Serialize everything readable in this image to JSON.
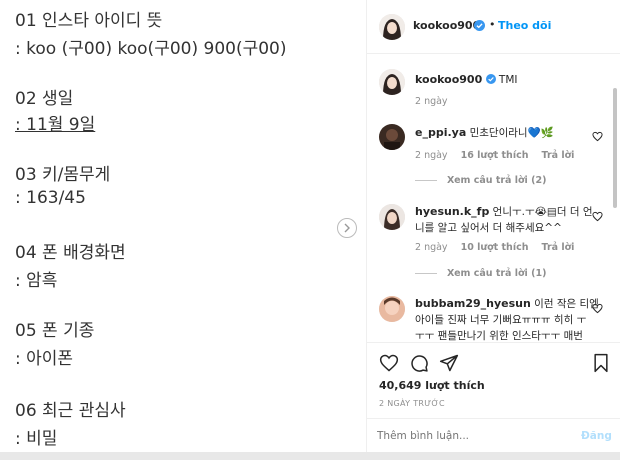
{
  "post_image": {
    "lines": [
      "01 인스타 아이디 뜻",
      ": koo (구00) koo(구00) 900(구00)",
      "02 생일",
      ": 11월 9일",
      "03 키/몸무게",
      ": 163/45",
      "04 폰 배경화면",
      ": 암흑",
      "05 폰 기종",
      ": 아이폰",
      "06 최근 관심사",
      ": 비밀"
    ]
  },
  "header": {
    "username": "kookoo900",
    "follow_label": "Theo dõi"
  },
  "caption": {
    "username": "kookoo900",
    "text": "TMI",
    "time": "2 ngày"
  },
  "comments": [
    {
      "username": "e_ppi.ya",
      "text": "민초단이라니💙🌿",
      "time": "2 ngày",
      "likes": "16 lượt thích",
      "reply": "Trả lời",
      "view_replies": "Xem câu trả lời (2)"
    },
    {
      "username": "hyesun.k_fp",
      "text_line1": "언니ㅜ.ㅜ😭▤더 더 언",
      "text_line2": "니를 알고 싶어서 더 해주세요^^",
      "time": "2 ngày",
      "likes": "10 lượt thích",
      "reply": "Trả lời",
      "view_replies": "Xem câu trả lời (1)"
    },
    {
      "username": "bubbam29_hyesun",
      "text_line1": "이런 작은 티엠",
      "text_line2": "아이들 진짜 너무 기뻐요ㅠㅠㅠ 히히 ㅜ",
      "text_line3": "ㅜㅜ 팬들만나기 위한 인스타ㅜㅜ 매번"
    }
  ],
  "actions": {
    "likes": "40,649 lượt thích",
    "date": "2 NGÀY TRƯỚC"
  },
  "add_comment": {
    "placeholder": "Thêm bình luận...",
    "post_label": "Đăng"
  },
  "colors": {
    "link_blue": "#0095f6",
    "verified": "#3897f0",
    "muted": "#8e8e8e"
  }
}
